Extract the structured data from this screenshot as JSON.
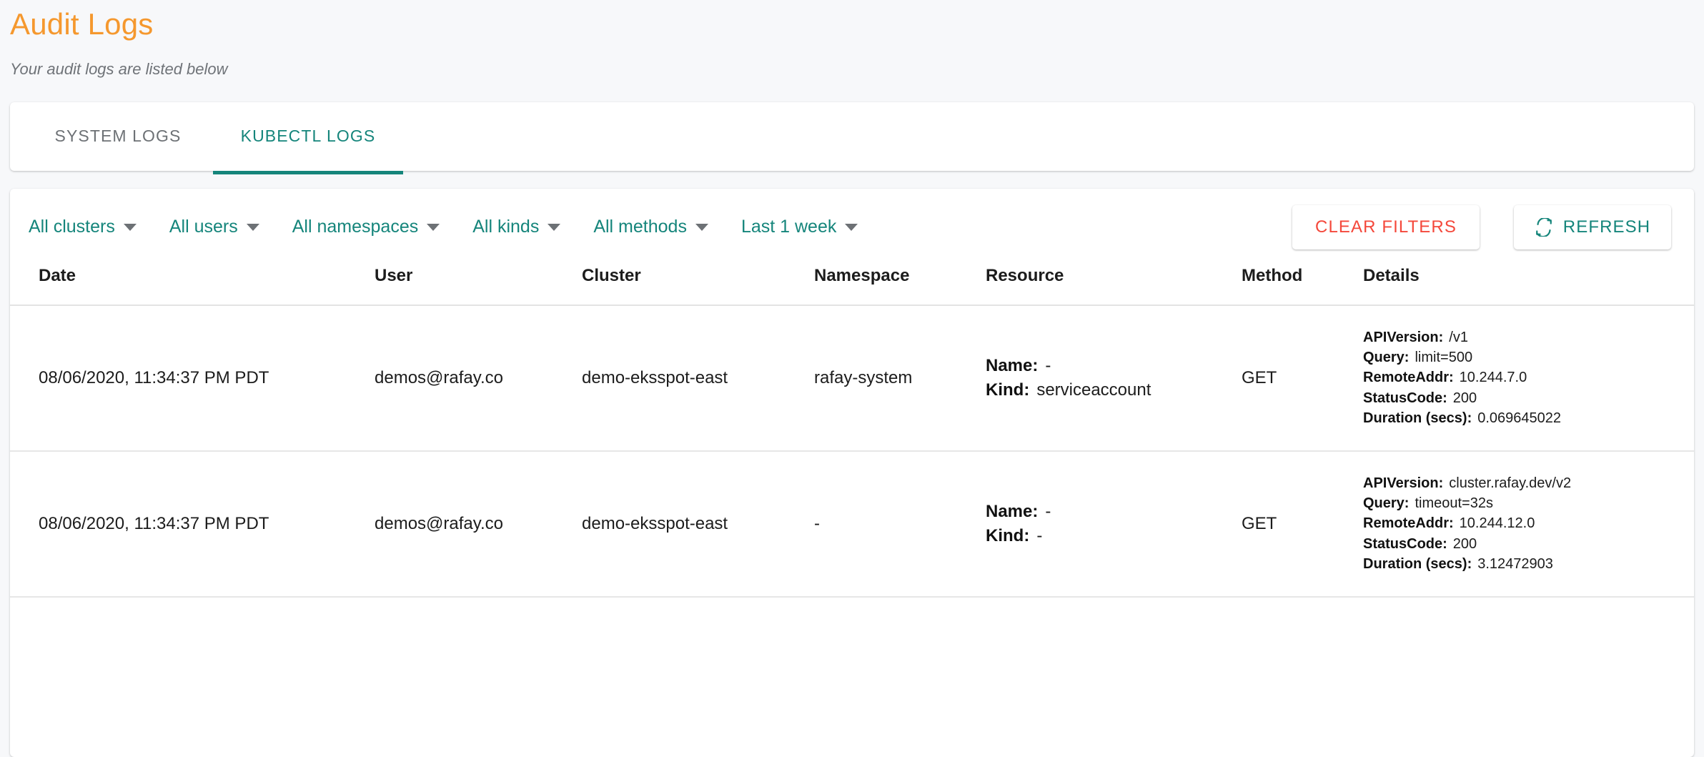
{
  "header": {
    "title": "Audit Logs",
    "subtitle": "Your audit logs are listed below"
  },
  "tabs": [
    {
      "label": "SYSTEM LOGS",
      "active": false
    },
    {
      "label": "KUBECTL LOGS",
      "active": true
    }
  ],
  "filters": [
    {
      "label": "All clusters",
      "icon": "chevron-down-icon"
    },
    {
      "label": "All users",
      "icon": "chevron-down-icon"
    },
    {
      "label": "All namespaces",
      "icon": "chevron-down-icon"
    },
    {
      "label": "All kinds",
      "icon": "chevron-down-icon"
    },
    {
      "label": "All methods",
      "icon": "chevron-down-icon"
    },
    {
      "label": "Last 1 week",
      "icon": "chevron-down-icon"
    }
  ],
  "actions": {
    "clear_filters_label": "CLEAR FILTERS",
    "refresh_label": "REFRESH",
    "refresh_icon": "refresh-icon"
  },
  "table": {
    "columns": [
      "Date",
      "User",
      "Cluster",
      "Namespace",
      "Resource",
      "Method",
      "Details"
    ],
    "rows": [
      {
        "date": "08/06/2020, 11:34:37 PM PDT",
        "user": "demos@rafay.co",
        "cluster": "demo-eksspot-east",
        "namespace": "rafay-system",
        "resource": {
          "name_key": "Name:",
          "name_value": "-",
          "kind_key": "Kind:",
          "kind_value": "serviceaccount"
        },
        "method": "GET",
        "details": {
          "apiversion_key": "APIVersion:",
          "apiversion_value": "/v1",
          "query_key": "Query:",
          "query_value": "limit=500",
          "remoteaddr_key": "RemoteAddr:",
          "remoteaddr_value": "10.244.7.0",
          "statuscode_key": "StatusCode:",
          "statuscode_value": "200",
          "duration_key": "Duration (secs):",
          "duration_value": "0.069645022"
        }
      },
      {
        "date": "08/06/2020, 11:34:37 PM PDT",
        "user": "demos@rafay.co",
        "cluster": "demo-eksspot-east",
        "namespace": "-",
        "resource": {
          "name_key": "Name:",
          "name_value": "-",
          "kind_key": "Kind:",
          "kind_value": "-"
        },
        "method": "GET",
        "details": {
          "apiversion_key": "APIVersion:",
          "apiversion_value": "cluster.rafay.dev/v2",
          "query_key": "Query:",
          "query_value": "timeout=32s",
          "remoteaddr_key": "RemoteAddr:",
          "remoteaddr_value": "10.244.12.0",
          "statuscode_key": "StatusCode:",
          "statuscode_value": "200",
          "duration_key": "Duration (secs):",
          "duration_value": "3.12472903"
        }
      }
    ]
  },
  "colors": {
    "title_orange": "#f5982e",
    "accent_teal": "#15857b",
    "danger_red": "#f4483b",
    "page_bg": "#f7f8fa",
    "card_bg": "#ffffff"
  }
}
